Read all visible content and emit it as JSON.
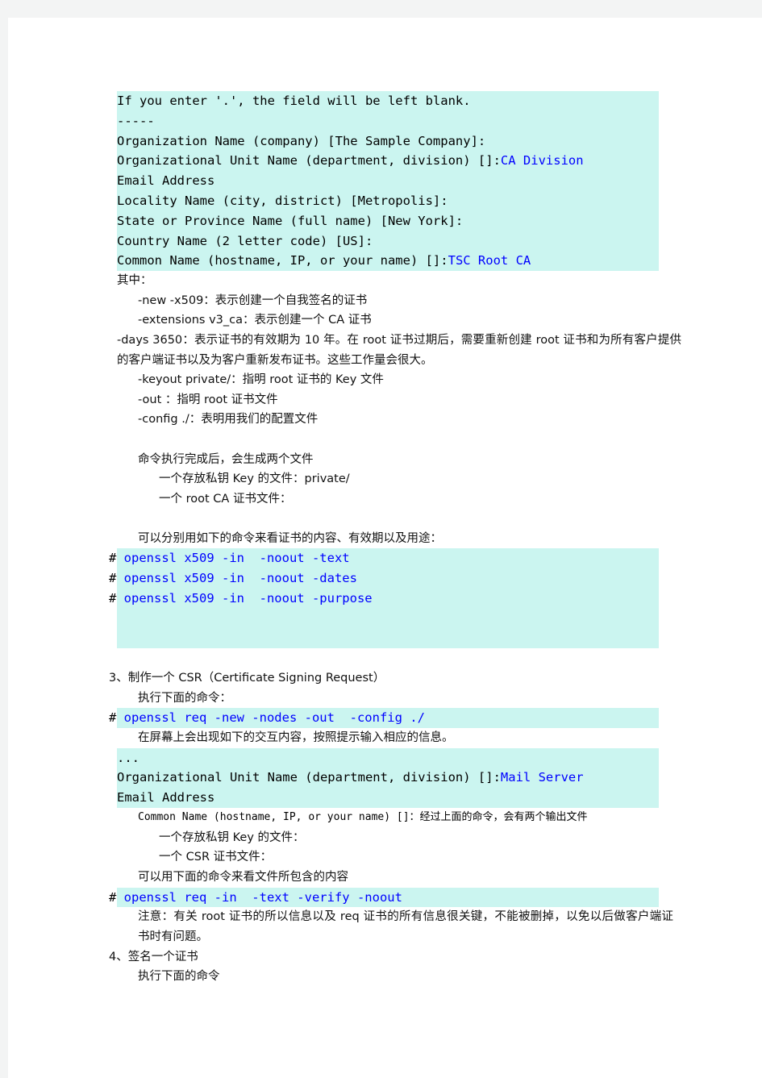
{
  "document": {
    "language": "zh-CN",
    "colors": {
      "highlight": "#cbf5f0",
      "command_blue": "#0000ff",
      "text": "#111111",
      "page_background": "#ffffff",
      "gutter": "#f3f4f4"
    }
  },
  "block_ca_prompt": {
    "line_1": "If you enter '.', the field will be left blank.",
    "line_2": "-----",
    "line_3": "Organization Name (company) [The Sample Company]:",
    "line_4_label": "Organizational Unit Name (department, division) []:",
    "line_4_value": "CA Division",
    "line_5": "Email Address",
    "line_6": "Locality Name (city, district) [Metropolis]:",
    "line_7": "State or Province Name (full name) [New York]:",
    "line_8": "Country Name (2 letter code) [US]:",
    "line_9_label": "Common Name (hostname, IP, or your name) []:",
    "line_9_value": "TSC Root CA"
  },
  "explain": {
    "heading": "其中：",
    "opt_new_x509": "-new -x509：表示创建一个自我签名的证书",
    "opt_extensions": "-extensions v3_ca：表示创建一个 CA 证书",
    "opt_days": "-days 3650：表示证书的有效期为 10 年。在 root 证书过期后，需要重新创建 root 证书和为所有客户提供的客户端证书以及为客户重新发布证书。这些工作量会很大。",
    "opt_keyout": "-keyout private/：指明 root 证书的 Key 文件",
    "opt_out": "-out ：指明 root 证书文件",
    "opt_config": "-config ./：表明用我们的配置文件",
    "result_heading": "命令执行完成后，会生成两个文件",
    "result_item_1": "一个存放私钥 Key 的文件：private/",
    "result_item_2": "一个 root CA 证书文件：",
    "view_heading": "可以分别用如下的命令来看证书的内容、有效期以及用途："
  },
  "block_x509_commands": {
    "prompt": "# ",
    "cmd_1": "openssl x509 -in  -noout -text",
    "cmd_2": "openssl x509 -in  -noout -dates",
    "cmd_3": "openssl x509 -in  -noout -purpose"
  },
  "section_csr": {
    "heading": "3、制作一个 CSR（Certificate Signing Request）",
    "sub_heading": "执行下面的命令：",
    "command_prompt": "# ",
    "command": "openssl req -new -nodes -out  -config ./",
    "note": "在屏幕上会出现如下的交互内容，按照提示输入相应的信息。"
  },
  "block_csr_prompt": {
    "line_1": "...",
    "line_2_label": "Organizational Unit Name (department, division) []:",
    "line_2_value": "Mail Server",
    "line_3": "Email Address"
  },
  "csr_result": {
    "common_name_line": "Common Name (hostname, IP, or your name) []：经过上面的命令，会有两个输出文件",
    "item_1": "一个存放私钥 Key 的文件：",
    "item_2": "一个 CSR 证书文件：",
    "view_heading": "可以用下面的命令来看文件所包含的内容"
  },
  "block_req_command": {
    "prompt": "# ",
    "cmd": "openssl req -in  -text -verify -noout"
  },
  "warning": {
    "text": "注意：有关 root 证书的所以信息以及 req 证书的所有信息很关键，不能被删掉，以免以后做客户端证书时有问题。"
  },
  "section_sign": {
    "heading": "4、签名一个证书",
    "sub_heading": "执行下面的命令"
  }
}
